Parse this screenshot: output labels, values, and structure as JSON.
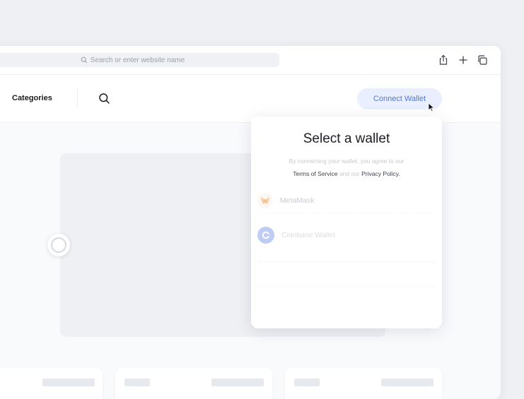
{
  "browser": {
    "search_placeholder": "Search or enter website name",
    "icons": [
      "share-icon",
      "new-tab-plus-icon",
      "tabs-overview-icon"
    ]
  },
  "navbar": {
    "categories_label": "Categories",
    "connect_wallet_label": "Connect Wallet"
  },
  "wallet_modal": {
    "title": "Select a wallet",
    "subtitle_prefix": "By connecting your wallet, you agree to our",
    "terms_label": "Terms of Service",
    "and_text": "and our",
    "privacy_label": "Privacy Policy.",
    "wallets": [
      {
        "name": "MetaMask",
        "icon": "metamask-fox-icon"
      },
      {
        "name": "Coinbase Wallet",
        "icon": "coinbase-icon"
      }
    ]
  },
  "colors": {
    "accent": "#4f78d6",
    "accent_bg": "#e9efff",
    "page_bg": "#eef0f4"
  }
}
